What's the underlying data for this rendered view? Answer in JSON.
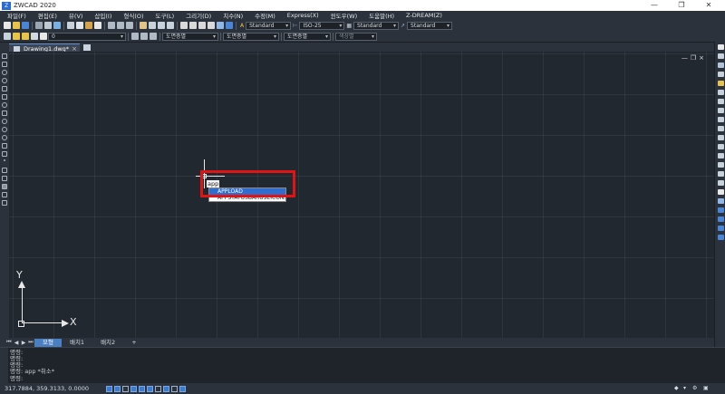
{
  "app": {
    "title": "ZWCAD 2020",
    "logo_text": "Z",
    "window_controls": [
      "—",
      "❐",
      "✕"
    ]
  },
  "menu": [
    "파일(F)",
    "편집(E)",
    "뷰(V)",
    "삽입(I)",
    "형식(O)",
    "도구(L)",
    "그리기(D)",
    "치수(N)",
    "수정(M)",
    "Express(X)",
    "윈도우(W)",
    "도움말(H)",
    "Z-DREAM(Z)"
  ],
  "toolbar1": {
    "text_style": "Standard",
    "dim_style": "ISO-25",
    "table_style": "Standard",
    "multileader_style": "Standard"
  },
  "toolbar2": {
    "layer": "0",
    "color": "도면층별",
    "linetype": "도면층별",
    "lineweight": "도면층별",
    "plotstyle": "색상별"
  },
  "file_tab": {
    "label": "Drawing1.dwg*",
    "close": "×"
  },
  "canvas": {
    "viewport_controls": "—❐×",
    "command_tooltip": "app",
    "autocomplete": [
      "APPLOAD",
      "APPSTATUSBARUSEICONS"
    ],
    "ucs_x": "X",
    "ucs_y": "Y"
  },
  "layout_tabs": {
    "nav": [
      "⏮",
      "◀",
      "▶",
      "⏭"
    ],
    "tabs": [
      "모형",
      "배치1",
      "배치2"
    ],
    "add": "+"
  },
  "command_window": {
    "lines": [
      "명령:",
      "명령:",
      "명령:",
      "명령: app *취소*",
      "명령:"
    ]
  },
  "status": {
    "coords": "317.7884, 359.3133, 0.0000",
    "right_items": [
      "◆",
      "▾",
      "⚙",
      "▣"
    ]
  },
  "colors": {
    "background": "#212830",
    "panel": "#2b323b",
    "accent": "#2f6dd1",
    "highlight": "#e01414"
  }
}
